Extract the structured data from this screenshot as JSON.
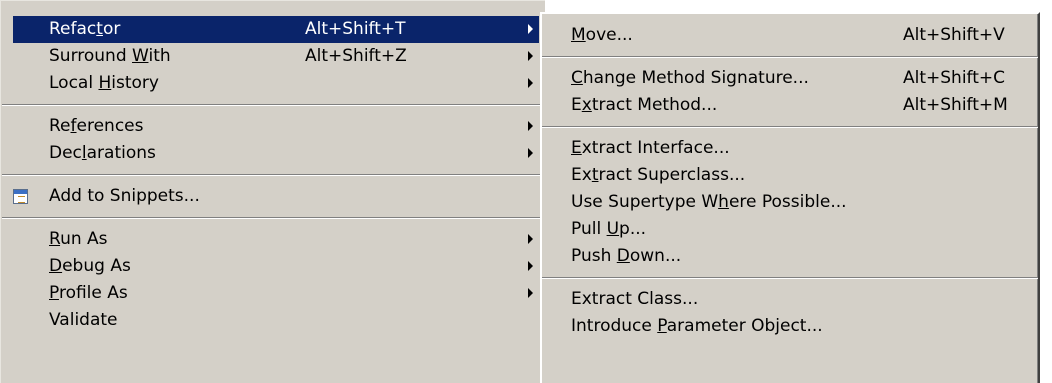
{
  "main_menu": {
    "items": [
      {
        "pre": "Refac",
        "mn": "t",
        "post": "or",
        "shortcut": "Alt+Shift+T",
        "submenu": true,
        "selected": true
      },
      {
        "pre": "Surround ",
        "mn": "W",
        "post": "ith",
        "shortcut": "Alt+Shift+Z",
        "submenu": true
      },
      {
        "pre": "Local ",
        "mn": "H",
        "post": "istory",
        "submenu": true
      },
      {
        "separator": true
      },
      {
        "pre": "Re",
        "mn": "f",
        "post": "erences",
        "submenu": true
      },
      {
        "pre": "Dec",
        "mn": "l",
        "post": "arations",
        "submenu": true
      },
      {
        "separator": true
      },
      {
        "pre": "Add to Snippets...",
        "mn": "",
        "post": "",
        "icon": "snippets-icon"
      },
      {
        "separator": true
      },
      {
        "pre": "",
        "mn": "R",
        "post": "un As",
        "submenu": true
      },
      {
        "pre": "",
        "mn": "D",
        "post": "ebug As",
        "submenu": true
      },
      {
        "pre": "",
        "mn": "P",
        "post": "rofile As",
        "submenu": true
      },
      {
        "pre": "Validate",
        "mn": "",
        "post": ""
      }
    ]
  },
  "sub_menu": {
    "items": [
      {
        "pre": "",
        "mn": "M",
        "post": "ove...",
        "shortcut": "Alt+Shift+V"
      },
      {
        "separator": true
      },
      {
        "pre": "",
        "mn": "C",
        "post": "hange Method Signature...",
        "shortcut": "Alt+Shift+C"
      },
      {
        "pre": "E",
        "mn": "x",
        "post": "tract Method...",
        "shortcut": "Alt+Shift+M"
      },
      {
        "separator": true
      },
      {
        "pre": "",
        "mn": "E",
        "post": "xtract Interface..."
      },
      {
        "pre": "Ex",
        "mn": "t",
        "post": "ract Superclass..."
      },
      {
        "pre": "Use Supertype W",
        "mn": "h",
        "post": "ere Possible..."
      },
      {
        "pre": "Pull ",
        "mn": "U",
        "post": "p..."
      },
      {
        "pre": "Push ",
        "mn": "D",
        "post": "own..."
      },
      {
        "separator": true
      },
      {
        "pre": "Extract Class...",
        "mn": "",
        "post": ""
      },
      {
        "pre": "Introduce ",
        "mn": "P",
        "post": "arameter Object..."
      }
    ]
  },
  "colors": {
    "menu_bg": "#d4d0c8",
    "selection_bg": "#0a246a",
    "selection_fg": "#ffffff"
  }
}
